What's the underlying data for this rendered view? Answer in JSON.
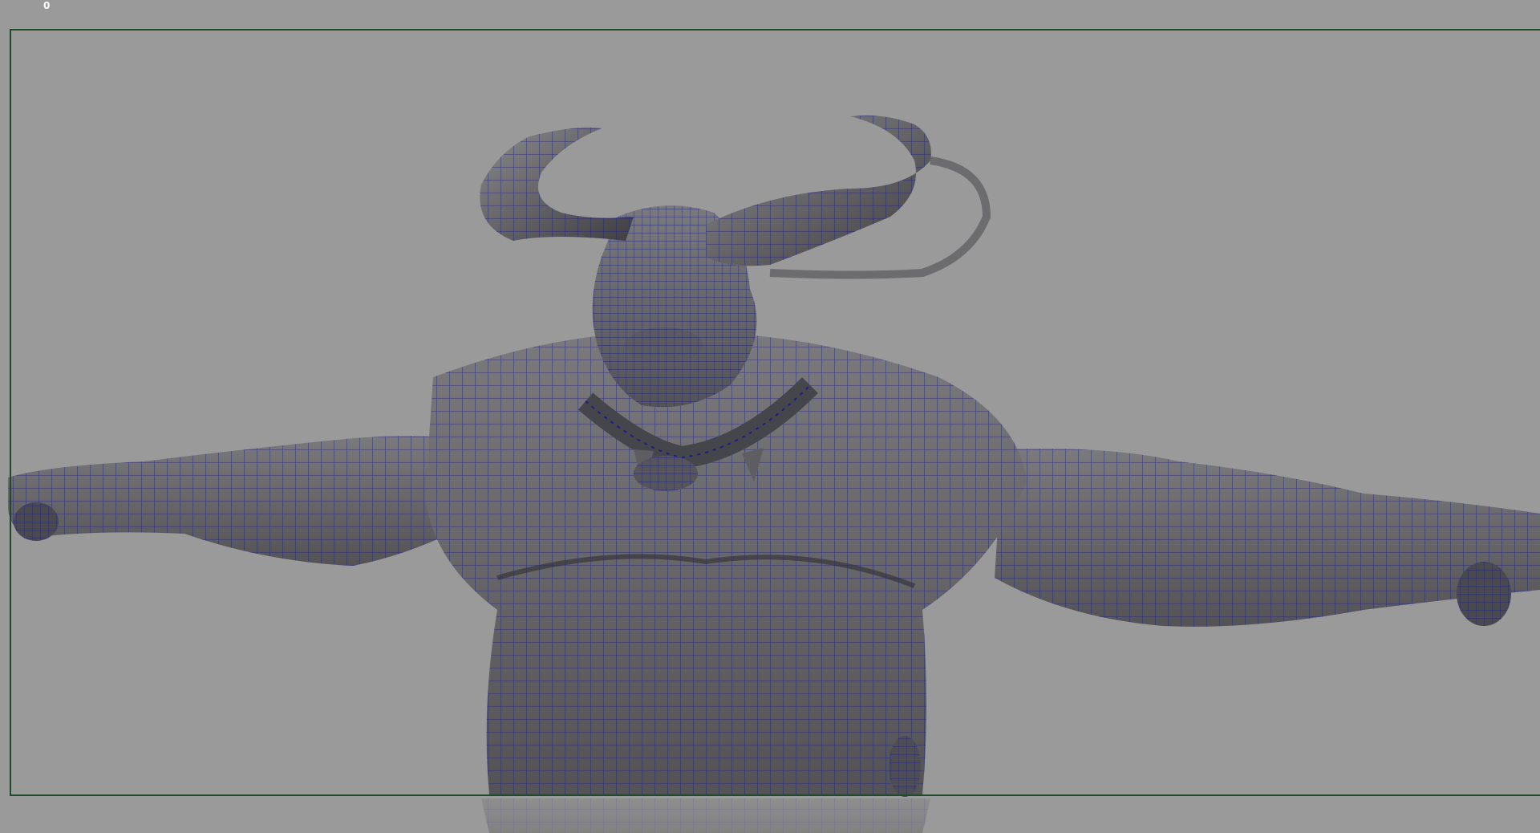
{
  "viewport": {
    "frame_counter": "0",
    "colors": {
      "background": "#9a9a9a",
      "gate_border": "#1f4a2a",
      "mesh_fill": "#6b6b6d",
      "mesh_shadow": "#3c3c40",
      "wireframe": "#1c1c8a"
    },
    "subject": "minotaur-character-mesh"
  }
}
